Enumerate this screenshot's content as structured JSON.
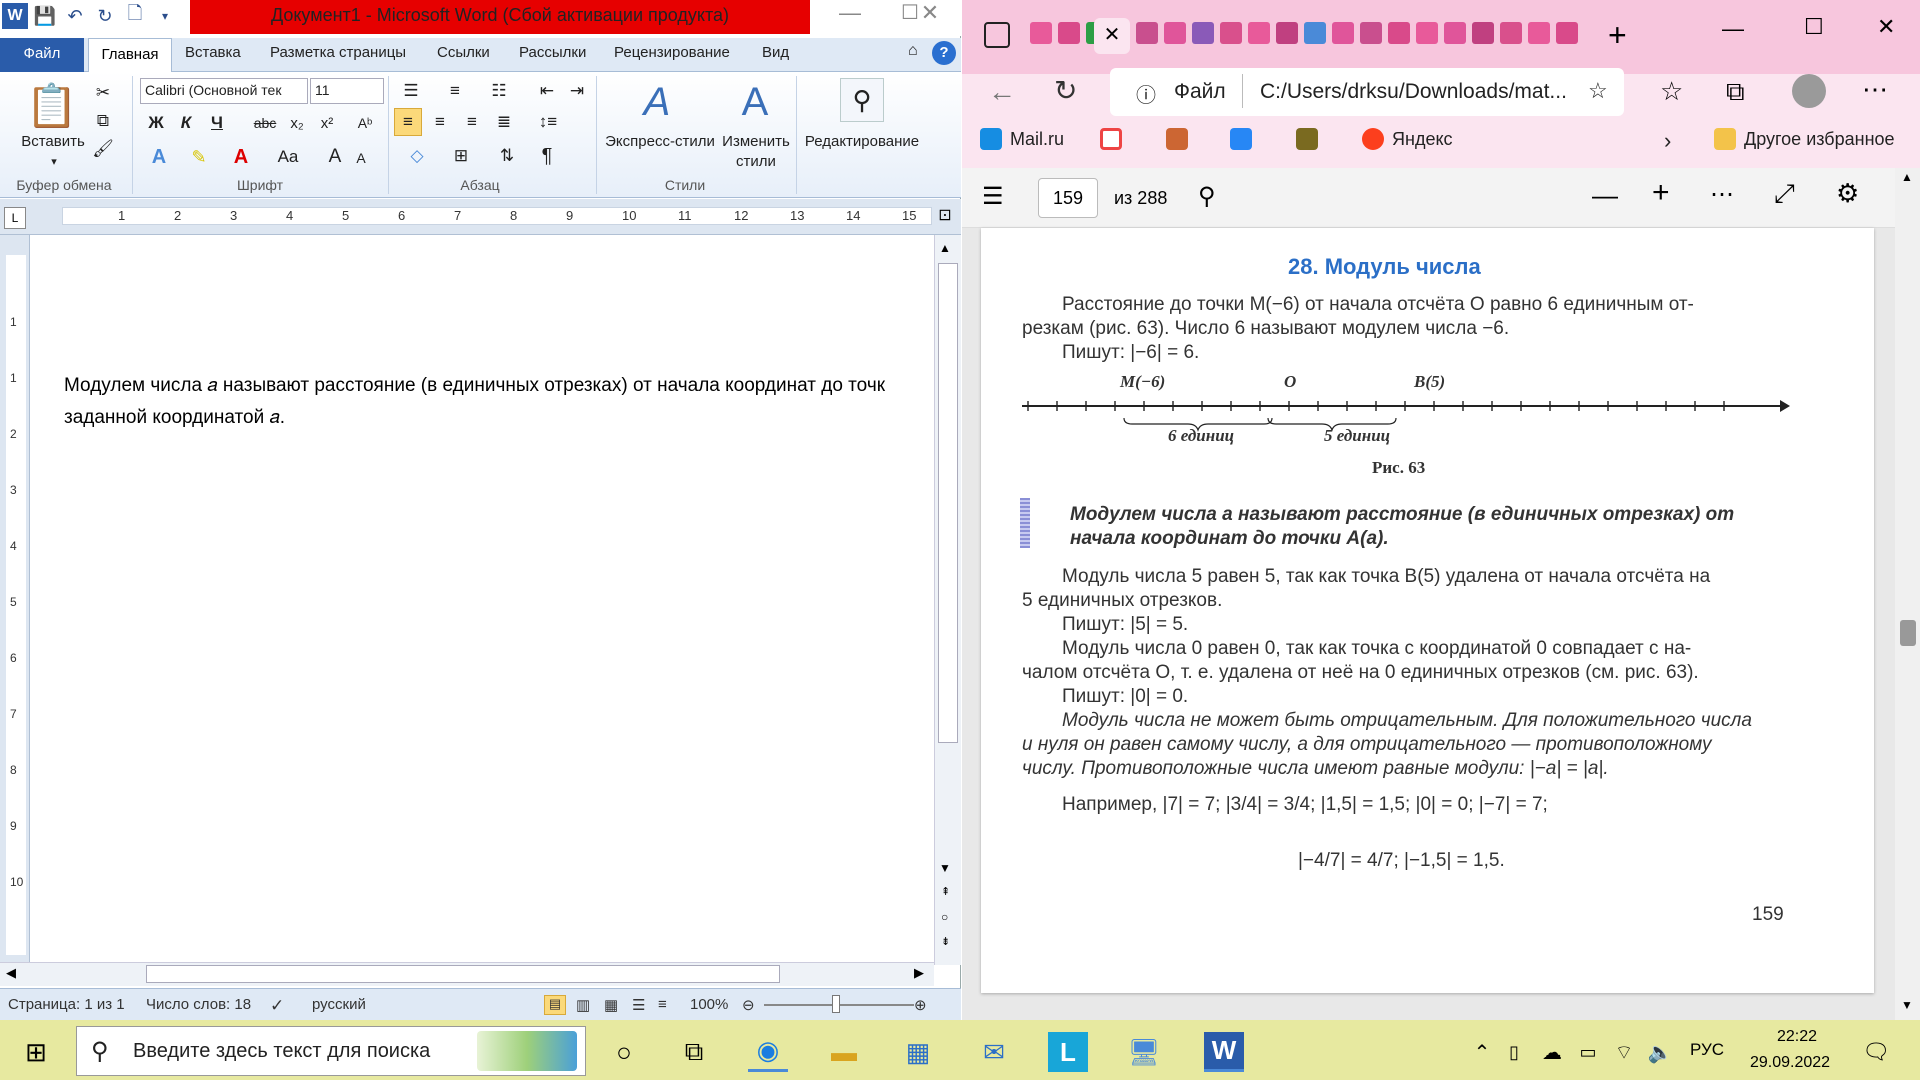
{
  "word": {
    "title": "Документ1  -  Microsoft Word (Сбой активации продукта)",
    "tabs": [
      "Файл",
      "Главная",
      "Вставка",
      "Разметка страницы",
      "Ссылки",
      "Рассылки",
      "Рецензирование",
      "Вид"
    ],
    "font_name": "Calibri (Основной тек",
    "font_size": "11",
    "paste_label": "Вставить",
    "express_styles": "Экспресс-стили",
    "change_styles": "Изменить стили",
    "editing": "Редактирование",
    "groups": [
      "Буфер обмена",
      "Шрифт",
      "Абзац",
      "Стили"
    ],
    "ruler_numbers": [
      "1",
      "2",
      "3",
      "4",
      "5",
      "6",
      "7",
      "8",
      "9",
      "10",
      "11",
      "12",
      "13",
      "14",
      "15"
    ],
    "vruler_numbers": [
      "1",
      "1",
      "2",
      "3",
      "4",
      "5",
      "6",
      "7",
      "8",
      "9",
      "10"
    ],
    "doc_line1": "Модулем числа 𝑎 называют расстояние (в единичных отрезках) от начала координат до точк",
    "doc_line2": "заданной координатой 𝑎.",
    "status_page": "Страница: 1 из 1",
    "status_words": "Число слов: 18",
    "status_lang": "русский",
    "zoom": "100%"
  },
  "edge": {
    "address_label": "Файл",
    "address": "C:/Users/drksu/Downloads/mat...",
    "favorites": [
      "Mail.ru",
      "Яндекс"
    ],
    "other_fav": "Другое избранное",
    "page_current": "159",
    "page_total": "из 288"
  },
  "book": {
    "title": "28. Модуль числа",
    "p1a": "Расстояние до точки M(−6) от начала отсчёта O равно 6 единичным от-",
    "p1b": "резкам (рис. 63). Число 6 называют модулем числа −6.",
    "p1c": "Пишут: |−6| = 6.",
    "label_m": "M(−6)",
    "label_o": "O",
    "label_b": "B(5)",
    "brace1": "6 единиц",
    "brace2": "5 единиц",
    "fig": "Рис. 63",
    "def1": "Модулем числа a называют расстояние (в единичных отрезках) от",
    "def2": "начала координат до точки A(a).",
    "p2a": "Модуль числа 5 равен 5, так как точка B(5) удалена от начала отсчёта на",
    "p2b": "5 единичных отрезков.",
    "p2c": "Пишут: |5| = 5.",
    "p3a": "Модуль числа 0 равен 0, так как точка с координатой 0 совпадает с на-",
    "p3b": "чалом отсчёта O, т. е. удалена от неё на 0 единичных отрезков (см. рис. 63).",
    "p3c": "Пишут: |0| = 0.",
    "p4a": "Модуль числа не может быть отрицательным. Для положительного числа",
    "p4b": "и нуля он равен самому числу, а для отрицательного — противоположному",
    "p4c": "числу. Противоположные числа имеют равные модули: |−a| = |a|.",
    "ex1": "Например, |7| = 7; |3/4| = 3/4; |1,5| = 1,5; |0| = 0; |−7| = 7;",
    "ex2": "|−4/7| = 4/7; |−1,5| = 1,5.",
    "page_no": "159"
  },
  "taskbar": {
    "search_placeholder": "Введите здесь текст для поиска",
    "lang": "РУС",
    "time": "22:22",
    "date": "29.09.2022"
  }
}
